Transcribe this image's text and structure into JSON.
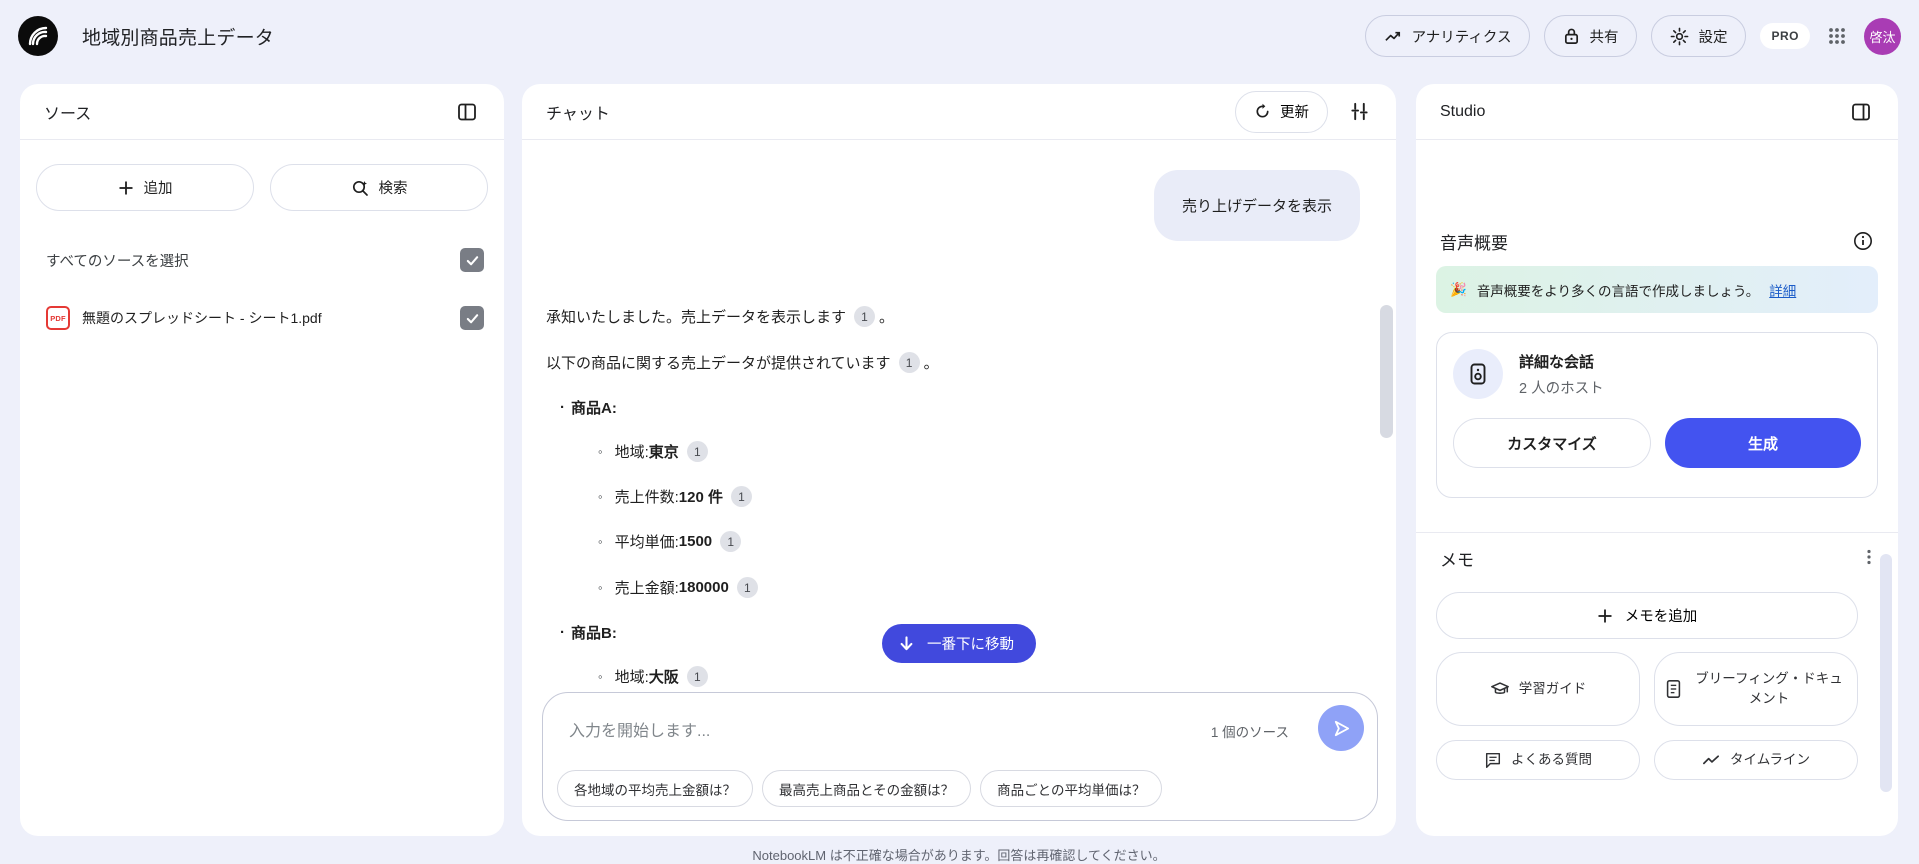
{
  "header": {
    "title": "地域別商品売上データ",
    "analytics_label": "アナリティクス",
    "share_label": "共有",
    "settings_label": "設定",
    "pro_badge": "PRO",
    "avatar_text": "啓汰"
  },
  "sources": {
    "title": "ソース",
    "add_label": "追加",
    "search_label": "検索",
    "select_all_label": "すべてのソースを選択",
    "items": [
      {
        "name": "無題のスプレッドシート - シート1.pdf",
        "badge": "PDF",
        "checked": true
      }
    ]
  },
  "chat": {
    "title": "チャット",
    "refresh_label": "更新",
    "user_message": "売り上げデータを表示",
    "citation_label": "1",
    "assistant": {
      "line1": "承知いたしました。売上データを表示します",
      "line2": "以下の商品に関する売上データが提供されています",
      "period": "。",
      "products": [
        {
          "name": "商品A:",
          "fields": [
            {
              "label": "地域: ",
              "value": "東京"
            },
            {
              "label": "売上件数: ",
              "value": "120 件"
            },
            {
              "label": "平均単価: ",
              "value": "1500"
            },
            {
              "label": "売上金額: ",
              "value": "180000"
            }
          ]
        },
        {
          "name": "商品B:",
          "fields": [
            {
              "label": "地域: ",
              "value": "大阪"
            }
          ]
        }
      ]
    },
    "scroll_to_bottom_label": "一番下に移動",
    "input_placeholder": "入力を開始します...",
    "source_count": "1 個のソース",
    "suggestions": [
      "各地域の平均売上金額は？",
      "最高売上商品とその金額は？",
      "商品ごとの平均単価は？"
    ]
  },
  "studio": {
    "title": "Studio",
    "audio_overview_title": "音声概要",
    "banner": {
      "emoji": "🎉",
      "text": "音声概要をより多くの言語で作成しましょう。",
      "link_label": "詳細"
    },
    "conversation_card": {
      "title": "詳細な会話",
      "subtitle": "2 人のホスト",
      "customize_label": "カスタマイズ",
      "generate_label": "生成"
    },
    "notes": {
      "title": "メモ",
      "add_label": "メモを追加",
      "buttons": [
        "学習ガイド",
        "ブリーフィング・ドキュメント",
        "よくある質問",
        "タイムライン"
      ]
    }
  },
  "footer": {
    "disclaimer": "NotebookLM は不正確な場合があります。回答は再確認してください。"
  },
  "colors": {
    "accent_blue": "#4353f0",
    "scroll_button_blue": "#4149dd",
    "send_button_periwinkle": "#8fa2f7",
    "avatar_purple": "#a93cb4",
    "user_bubble": "#e9ecf8",
    "page_background": "#eef0fa",
    "pdf_red": "#e53935",
    "banner_green": "#dcf3e4",
    "link_blue": "#1a5bc8"
  },
  "icons": {
    "logo": "notebooklm-arcs",
    "analytics": "trending-up",
    "share": "lock",
    "settings": "gear",
    "apps": "grid-3x3",
    "add": "plus",
    "search": "magnifier-sparkle",
    "refresh": "circular-arrow",
    "tune": "sliders",
    "send": "paper-plane",
    "scroll": "arrow-down",
    "audio_card": "speaker",
    "study_guide": "graduation-cap",
    "briefing": "document",
    "faq": "speech-bubble",
    "timeline": "zigzag-line"
  }
}
